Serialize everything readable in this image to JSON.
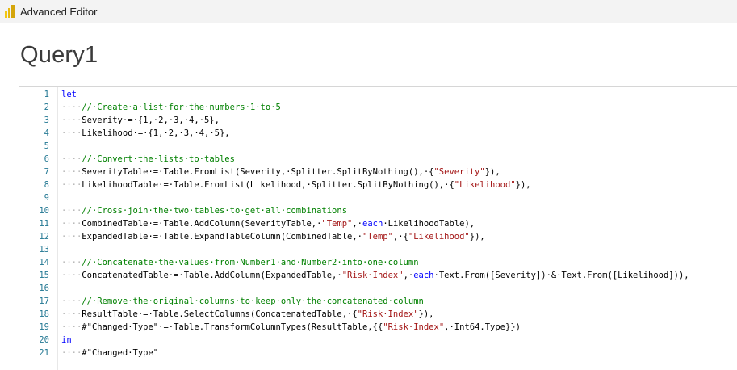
{
  "window": {
    "title": "Advanced Editor"
  },
  "query": {
    "title": "Query1"
  },
  "colors": {
    "keyword": "#0000ff",
    "comment": "#008000",
    "string": "#a31515",
    "line_number": "#237893"
  },
  "editor": {
    "lines": [
      {
        "n": "1",
        "segs": [
          [
            "kw",
            "let"
          ]
        ]
      },
      {
        "n": "2",
        "segs": [
          [
            "ws",
            "····"
          ],
          [
            "cm",
            "//·Create·a·list·for·the·numbers·1·to·5"
          ]
        ]
      },
      {
        "n": "3",
        "segs": [
          [
            "ws",
            "····"
          ],
          [
            "tx",
            "Severity·=·{1,·2,·3,·4,·5},"
          ]
        ]
      },
      {
        "n": "4",
        "segs": [
          [
            "ws",
            "····"
          ],
          [
            "tx",
            "Likelihood·=·{1,·2,·3,·4,·5},"
          ]
        ]
      },
      {
        "n": "5",
        "segs": []
      },
      {
        "n": "6",
        "segs": [
          [
            "ws",
            "····"
          ],
          [
            "cm",
            "//·Convert·the·lists·to·tables"
          ]
        ]
      },
      {
        "n": "7",
        "segs": [
          [
            "ws",
            "····"
          ],
          [
            "tx",
            "SeverityTable·=·Table.FromList(Severity,·Splitter.SplitByNothing(),·{"
          ],
          [
            "st",
            "\"Severity\""
          ],
          [
            "tx",
            "}),"
          ]
        ]
      },
      {
        "n": "8",
        "segs": [
          [
            "ws",
            "····"
          ],
          [
            "tx",
            "LikelihoodTable·=·Table.FromList(Likelihood,·Splitter.SplitByNothing(),·{"
          ],
          [
            "st",
            "\"Likelihood\""
          ],
          [
            "tx",
            "}),"
          ]
        ]
      },
      {
        "n": "9",
        "segs": []
      },
      {
        "n": "10",
        "segs": [
          [
            "ws",
            "····"
          ],
          [
            "cm",
            "//·Cross·join·the·two·tables·to·get·all·combinations"
          ]
        ]
      },
      {
        "n": "11",
        "segs": [
          [
            "ws",
            "····"
          ],
          [
            "tx",
            "CombinedTable·=·Table.AddColumn(SeverityTable,·"
          ],
          [
            "st",
            "\"Temp\""
          ],
          [
            "tx",
            ",·"
          ],
          [
            "kw",
            "each"
          ],
          [
            "tx",
            "·LikelihoodTable),"
          ]
        ]
      },
      {
        "n": "12",
        "segs": [
          [
            "ws",
            "····"
          ],
          [
            "tx",
            "ExpandedTable·=·Table.ExpandTableColumn(CombinedTable,·"
          ],
          [
            "st",
            "\"Temp\""
          ],
          [
            "tx",
            ",·{"
          ],
          [
            "st",
            "\"Likelihood\""
          ],
          [
            "tx",
            "}),"
          ]
        ]
      },
      {
        "n": "13",
        "segs": []
      },
      {
        "n": "14",
        "segs": [
          [
            "ws",
            "····"
          ],
          [
            "cm",
            "//·Concatenate·the·values·from·Number1·and·Number2·into·one·column"
          ]
        ]
      },
      {
        "n": "15",
        "segs": [
          [
            "ws",
            "····"
          ],
          [
            "tx",
            "ConcatenatedTable·=·Table.AddColumn(ExpandedTable,·"
          ],
          [
            "st",
            "\"Risk·Index\""
          ],
          [
            "tx",
            ",·"
          ],
          [
            "kw",
            "each"
          ],
          [
            "tx",
            "·Text.From([Severity])·&·Text.From([Likelihood])),"
          ]
        ]
      },
      {
        "n": "16",
        "segs": []
      },
      {
        "n": "17",
        "segs": [
          [
            "ws",
            "····"
          ],
          [
            "cm",
            "//·Remove·the·original·columns·to·keep·only·the·concatenated·column"
          ]
        ]
      },
      {
        "n": "18",
        "segs": [
          [
            "ws",
            "····"
          ],
          [
            "tx",
            "ResultTable·=·Table.SelectColumns(ConcatenatedTable,·{"
          ],
          [
            "st",
            "\"Risk·Index\""
          ],
          [
            "tx",
            "}),"
          ]
        ]
      },
      {
        "n": "19",
        "segs": [
          [
            "ws",
            "····"
          ],
          [
            "tx",
            "#\"Changed·Type\"·=·Table.TransformColumnTypes(ResultTable,{{"
          ],
          [
            "st",
            "\"Risk·Index\""
          ],
          [
            "tx",
            ",·Int64.Type}})"
          ]
        ]
      },
      {
        "n": "20",
        "segs": [
          [
            "kw",
            "in"
          ]
        ]
      },
      {
        "n": "21",
        "segs": [
          [
            "ws",
            "····"
          ],
          [
            "tx",
            "#\"Changed·Type\""
          ]
        ]
      }
    ]
  }
}
